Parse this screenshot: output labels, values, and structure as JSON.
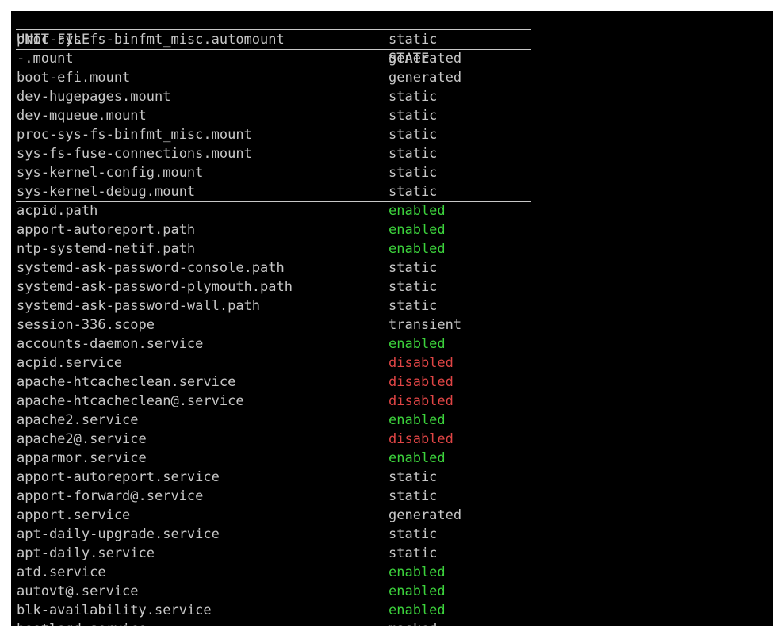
{
  "header": {
    "unit_file": "UNIT FILE",
    "state": "STATE"
  },
  "colors": {
    "enabled": "#3cd23c",
    "disabled": "#e04545",
    "default": "#c8c8c8",
    "background": "#000000"
  },
  "rows": [
    {
      "unit": "proc-sys-fs-binfmt_misc.automount",
      "state": "static",
      "group_start": true
    },
    {
      "unit": "-.mount",
      "state": "generated",
      "group_start": true
    },
    {
      "unit": "boot-efi.mount",
      "state": "generated"
    },
    {
      "unit": "dev-hugepages.mount",
      "state": "static"
    },
    {
      "unit": "dev-mqueue.mount",
      "state": "static"
    },
    {
      "unit": "proc-sys-fs-binfmt_misc.mount",
      "state": "static"
    },
    {
      "unit": "sys-fs-fuse-connections.mount",
      "state": "static"
    },
    {
      "unit": "sys-kernel-config.mount",
      "state": "static"
    },
    {
      "unit": "sys-kernel-debug.mount",
      "state": "static"
    },
    {
      "unit": "acpid.path",
      "state": "enabled",
      "group_start": true
    },
    {
      "unit": "apport-autoreport.path",
      "state": "enabled"
    },
    {
      "unit": "ntp-systemd-netif.path",
      "state": "enabled"
    },
    {
      "unit": "systemd-ask-password-console.path",
      "state": "static"
    },
    {
      "unit": "systemd-ask-password-plymouth.path",
      "state": "static"
    },
    {
      "unit": "systemd-ask-password-wall.path",
      "state": "static"
    },
    {
      "unit": "session-336.scope",
      "state": "transient",
      "group_start": true
    },
    {
      "unit": "accounts-daemon.service",
      "state": "enabled",
      "group_start": true
    },
    {
      "unit": "acpid.service",
      "state": "disabled"
    },
    {
      "unit": "apache-htcacheclean.service",
      "state": "disabled"
    },
    {
      "unit": "apache-htcacheclean@.service",
      "state": "disabled"
    },
    {
      "unit": "apache2.service",
      "state": "enabled"
    },
    {
      "unit": "apache2@.service",
      "state": "disabled"
    },
    {
      "unit": "apparmor.service",
      "state": "enabled"
    },
    {
      "unit": "apport-autoreport.service",
      "state": "static"
    },
    {
      "unit": "apport-forward@.service",
      "state": "static"
    },
    {
      "unit": "apport.service",
      "state": "generated"
    },
    {
      "unit": "apt-daily-upgrade.service",
      "state": "static"
    },
    {
      "unit": "apt-daily.service",
      "state": "static"
    },
    {
      "unit": "atd.service",
      "state": "enabled"
    },
    {
      "unit": "autovt@.service",
      "state": "enabled"
    },
    {
      "unit": "blk-availability.service",
      "state": "enabled"
    },
    {
      "unit": "bootlogd.service",
      "state": "masked"
    }
  ]
}
